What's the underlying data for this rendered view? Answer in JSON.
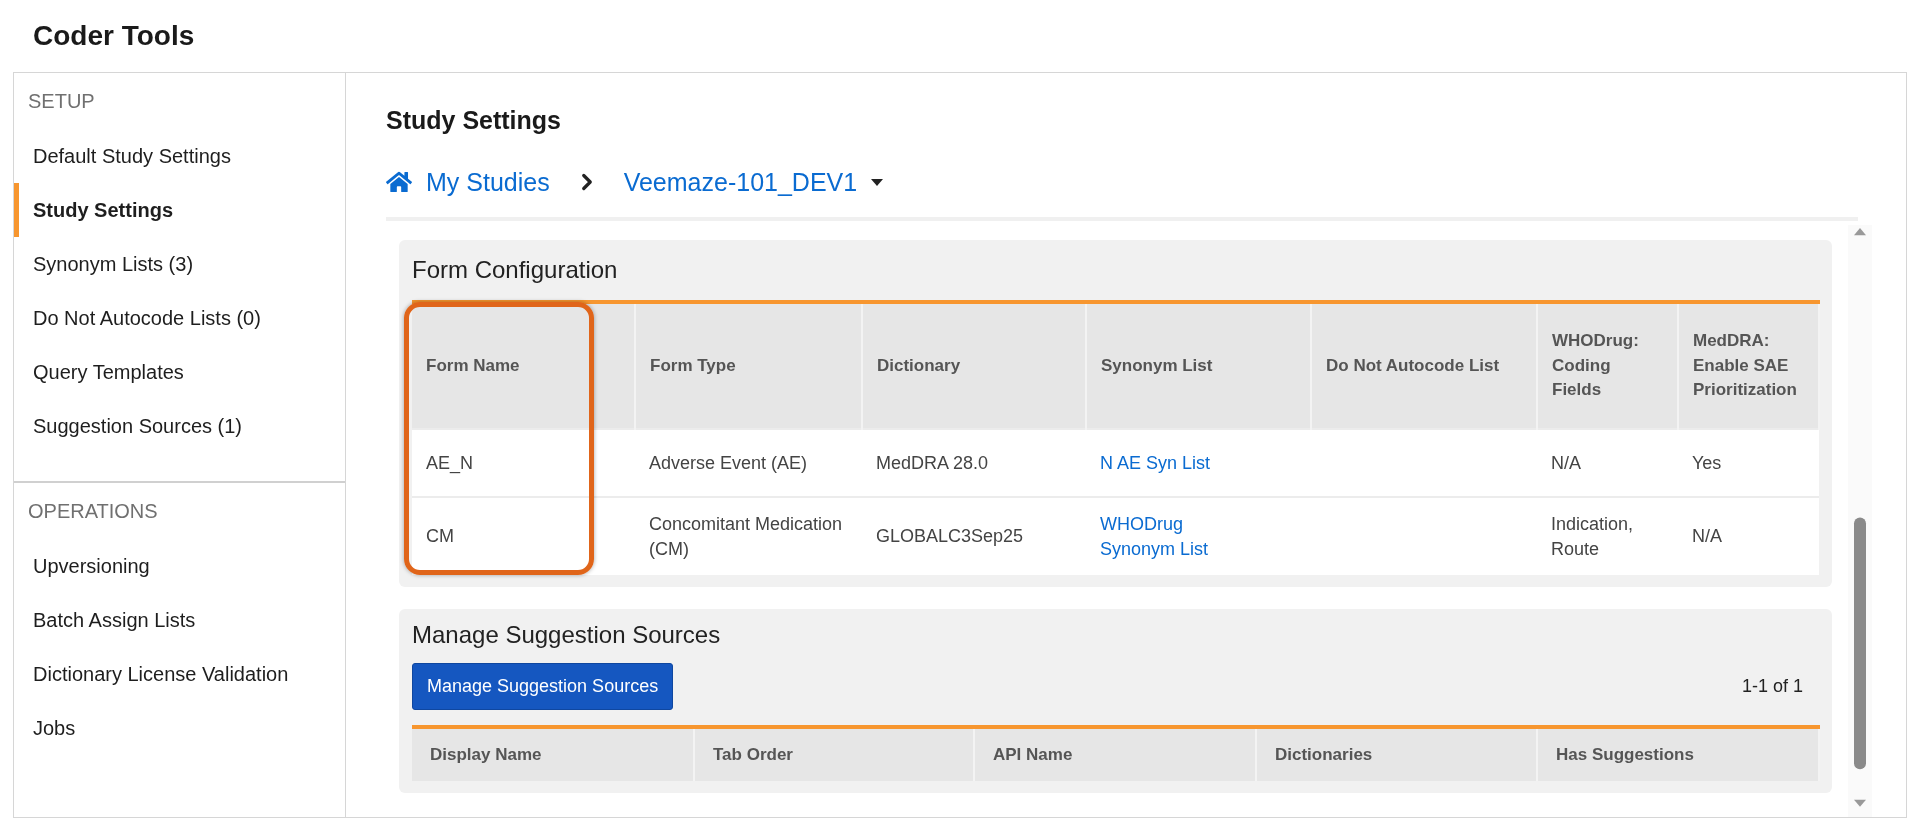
{
  "app_title": "Coder Tools",
  "sidebar": {
    "sections": [
      {
        "heading": "SETUP",
        "items": [
          {
            "label": "Default Study Settings",
            "selected": false
          },
          {
            "label": "Study Settings",
            "selected": true
          },
          {
            "label": "Synonym Lists (3)",
            "selected": false
          },
          {
            "label": "Do Not Autocode Lists (0)",
            "selected": false
          },
          {
            "label": "Query Templates",
            "selected": false
          },
          {
            "label": "Suggestion Sources (1)",
            "selected": false
          }
        ]
      },
      {
        "heading": "OPERATIONS",
        "items": [
          {
            "label": "Upversioning",
            "selected": false
          },
          {
            "label": "Batch Assign Lists",
            "selected": false
          },
          {
            "label": "Dictionary License Validation",
            "selected": false
          },
          {
            "label": "Jobs",
            "selected": false
          }
        ]
      }
    ]
  },
  "page_title": "Study Settings",
  "breadcrumb": {
    "home": "My Studies",
    "study": "Veemaze-101_DEV1"
  },
  "form_configuration": {
    "title": "Form Configuration",
    "columns": [
      {
        "label": "Form Name",
        "highlighted": true
      },
      {
        "label": "Form Type",
        "highlighted": false
      },
      {
        "label": "Dictionary",
        "highlighted": false
      },
      {
        "label": "Synonym List",
        "highlighted": false
      },
      {
        "label": "Do Not Autocode List",
        "highlighted": false
      },
      {
        "label": "WHODrug: Coding Fields",
        "highlighted": false
      },
      {
        "label": "MedDRA: Enable SAE Prioritization",
        "highlighted": false
      }
    ],
    "rows": [
      {
        "cells": [
          {
            "kind": "text",
            "text": "AE_N"
          },
          {
            "kind": "text",
            "text": "Adverse Event (AE)"
          },
          {
            "kind": "text",
            "text": "MedDRA 28.0"
          },
          {
            "kind": "link",
            "text": "N AE Syn List"
          },
          {
            "kind": "empty"
          },
          {
            "kind": "text",
            "text": "N/A"
          },
          {
            "kind": "text",
            "text": "Yes"
          }
        ]
      },
      {
        "cells": [
          {
            "kind": "text",
            "text": "CM"
          },
          {
            "kind": "text",
            "text": "Concomitant Medication (CM)"
          },
          {
            "kind": "text",
            "text": "GLOBALC3Sep25"
          },
          {
            "kind": "link",
            "text": "WHODrug Synonym List"
          },
          {
            "kind": "empty"
          },
          {
            "kind": "text",
            "text": "Indication, Route"
          },
          {
            "kind": "text",
            "text": "N/A"
          }
        ]
      }
    ]
  },
  "suggestion_sources": {
    "title": "Manage Suggestion Sources",
    "button": "Manage Suggestion Sources",
    "pagination": "1-1 of 1",
    "columns": [
      "Display Name",
      "Tab Order",
      "API Name",
      "Dictionaries",
      "Has Suggestions"
    ]
  }
}
